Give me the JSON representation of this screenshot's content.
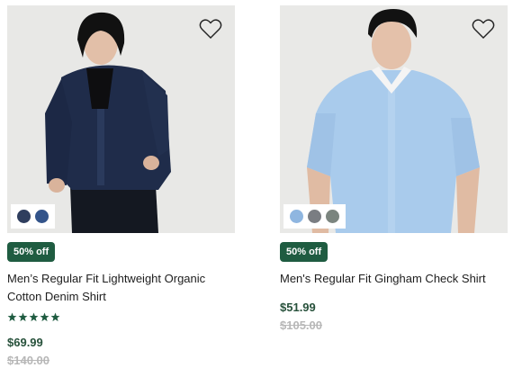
{
  "accent_color": "#1f5c41",
  "products": [
    {
      "badge": "50% off",
      "name": "Men’s Regular Fit Lightweight Organic Cotton Denim Shirt",
      "rating": 5,
      "rating_max": 5,
      "price": "$69.99",
      "original_price": "$140.00",
      "swatches": [
        "#2f3e5e",
        "#33548a"
      ],
      "wishlist_icon": "heart-outline-icon"
    },
    {
      "badge": "50% off",
      "name": "Men's Regular Fit Gingham Check Shirt",
      "price": "$51.99",
      "original_price": "$105.00",
      "swatches": [
        "#8fb6e0",
        "#7a7d82",
        "#7b857f"
      ],
      "wishlist_icon": "heart-outline-icon"
    }
  ]
}
